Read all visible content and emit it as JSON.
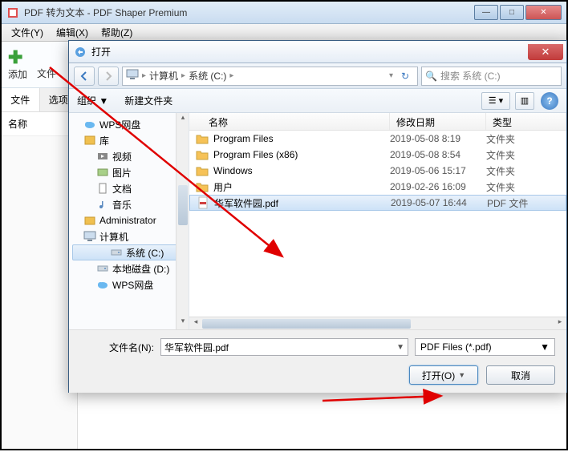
{
  "app": {
    "title": "PDF 转为文本 - PDF Shaper Premium",
    "menu": {
      "file": "文件(Y)",
      "edit": "编辑(X)",
      "help": "帮助(Z)"
    },
    "toolbar": {
      "add": "添加",
      "file": "文件"
    },
    "tabs": {
      "file": "文件",
      "options": "选项"
    },
    "columns": {
      "name": "名称"
    }
  },
  "dialog": {
    "title": "打开",
    "breadcrumb": {
      "root": "计算机",
      "drive": "系统 (C:)"
    },
    "search_placeholder": "搜索 系统 (C:)",
    "toolbar": {
      "organize": "组织 ▼",
      "new_folder": "新建文件夹",
      "view_label": "☰ ▾"
    },
    "tree": [
      {
        "label": "WPS网盘",
        "level": 1,
        "icon": "cloud"
      },
      {
        "label": "库",
        "level": 1,
        "icon": "library"
      },
      {
        "label": "视频",
        "level": 2,
        "icon": "video"
      },
      {
        "label": "图片",
        "level": 2,
        "icon": "image"
      },
      {
        "label": "文档",
        "level": 2,
        "icon": "doc"
      },
      {
        "label": "音乐",
        "level": 2,
        "icon": "music"
      },
      {
        "label": "Administrator",
        "level": 1,
        "icon": "user"
      },
      {
        "label": "计算机",
        "level": 1,
        "icon": "computer"
      },
      {
        "label": "系统 (C:)",
        "level": 2,
        "icon": "drive",
        "selected": true
      },
      {
        "label": "本地磁盘 (D:)",
        "level": 2,
        "icon": "drive"
      },
      {
        "label": "WPS网盘",
        "level": 2,
        "icon": "cloud"
      }
    ],
    "columns": {
      "name": "名称",
      "date": "修改日期",
      "type": "类型"
    },
    "files": [
      {
        "name": "Program Files",
        "date": "2019-05-08 8:19",
        "type": "文件夹",
        "kind": "folder"
      },
      {
        "name": "Program Files (x86)",
        "date": "2019-05-08 8:54",
        "type": "文件夹",
        "kind": "folder"
      },
      {
        "name": "Windows",
        "date": "2019-05-06 15:17",
        "type": "文件夹",
        "kind": "folder"
      },
      {
        "name": "用户",
        "date": "2019-02-26 16:09",
        "type": "文件夹",
        "kind": "folder"
      },
      {
        "name": "华军软件园.pdf",
        "date": "2019-05-07 16:44",
        "type": "PDF 文件",
        "kind": "pdf",
        "selected": true
      }
    ],
    "filename_label": "文件名(N):",
    "filename_value": "华军软件园.pdf",
    "filter": "PDF Files (*.pdf)",
    "open_btn": "打开(O)",
    "cancel_btn": "取消"
  }
}
